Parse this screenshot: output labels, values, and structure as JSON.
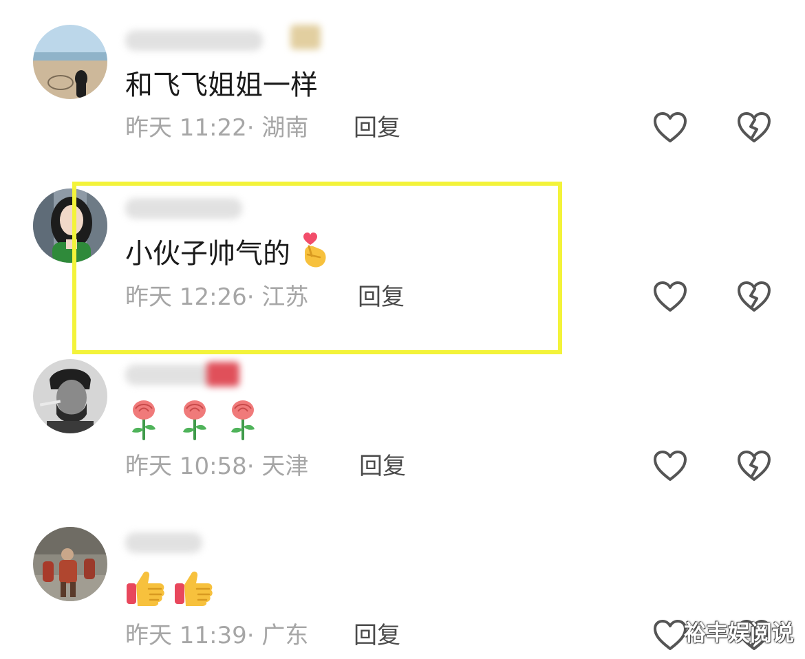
{
  "comments": [
    {
      "content": "和飞飞姐姐一样",
      "time": "昨天 11:22",
      "location": "· 湖南",
      "reply_label": "回复"
    },
    {
      "content": "小伙子帅气的",
      "time": "昨天 12:26",
      "location": "· 江苏",
      "reply_label": "回复"
    },
    {
      "content": "",
      "time": "昨天 10:58",
      "location": "· 天津",
      "reply_label": "回复"
    },
    {
      "content": "",
      "time": "昨天 11:39",
      "location": "· 广东",
      "reply_label": "回复"
    }
  ],
  "icons": {
    "like": "heart-outline-icon",
    "dislike": "broken-heart-icon",
    "emoji_rose": "rose-emoji",
    "emoji_thumbs_up": "thumbs-up-emoji",
    "emoji_finger_heart": "finger-heart-emoji"
  },
  "colors": {
    "highlight": "#f3f33a",
    "meta_text": "#a6a6a6",
    "reply_text": "#4a4a4a",
    "icon_stroke": "#555555"
  },
  "watermark": "裕丰娱阅说"
}
